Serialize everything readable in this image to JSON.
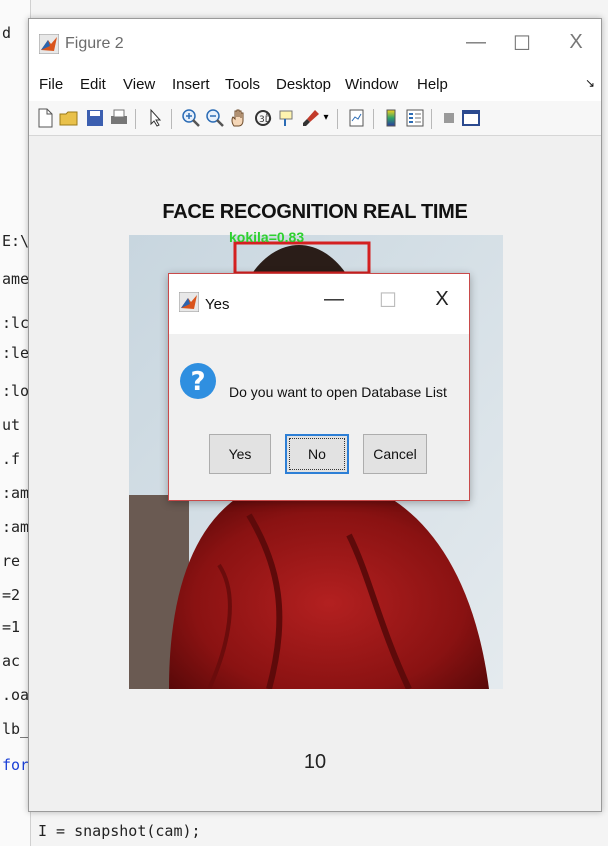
{
  "editor": {
    "lines": [
      "d",
      "",
      "",
      "",
      "E:\\U",
      "ame",
      ":lc",
      ":le",
      ":lo",
      "ut",
      ".f",
      ":am",
      ":am",
      "re",
      "=2",
      "=1",
      "ac",
      ".oa",
      "lb_",
      "for"
    ],
    "bottom_code": "I = snapshot(cam);"
  },
  "figure": {
    "title": "Figure 2",
    "window_buttons": {
      "minimize": "—",
      "maximize": "☐",
      "close": "X"
    },
    "menu": [
      "File",
      "Edit",
      "View",
      "Insert",
      "Tools",
      "Desktop",
      "Window",
      "Help"
    ],
    "menu_arrow": "↘",
    "toolbar_icons": [
      "new-file-icon",
      "open-folder-icon",
      "save-icon",
      "print-icon",
      "pointer-icon",
      "zoom-in-icon",
      "zoom-out-icon",
      "pan-icon",
      "rotate-icon",
      "data-cursor-icon",
      "brush-icon",
      "link-icon",
      "colorbar-icon",
      "legend-icon",
      "hide-plot-tools-icon",
      "show-plot-tools-icon"
    ],
    "plot_title": "FACE RECOGNITION REAL TIME",
    "face_label": "kokila=0.83",
    "counter": "10"
  },
  "dialog": {
    "title": "Yes",
    "window_buttons": {
      "minimize": "—",
      "maximize": "☐",
      "close": "X"
    },
    "message": "Do you want to open Database List",
    "icon_glyph": "?",
    "buttons": {
      "yes": "Yes",
      "no": "No",
      "cancel": "Cancel"
    }
  },
  "colors": {
    "face_box": "#d42020",
    "face_label": "#2fd12f",
    "question_icon": "#2f8fe0",
    "dialog_border": "#c94a4a"
  }
}
